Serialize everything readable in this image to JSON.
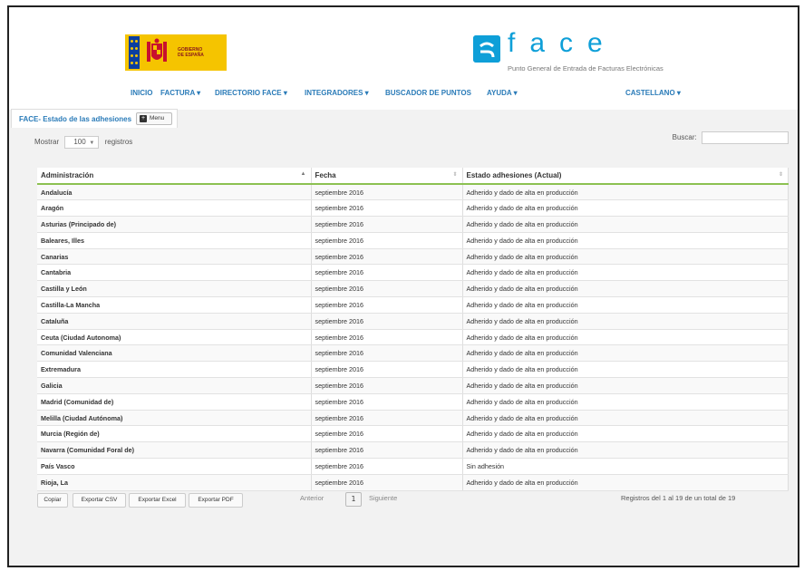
{
  "logos": {
    "gov_text_line1": "GOBIERNO",
    "gov_text_line2": "DE ESPAÑA",
    "face_word": "face",
    "face_tagline": "Punto General de Entrada de Facturas Electrónicas"
  },
  "nav": {
    "inicio": "INICIO",
    "factura": "FACTURA ▾",
    "directorio": "DIRECTORIO FACE ▾",
    "integradores": "INTEGRADORES ▾",
    "buscador": "BUSCADOR DE PUNTOS",
    "ayuda": "AYUDA ▾",
    "idioma": "CASTELLANO ▾"
  },
  "panel": {
    "title": "FACE- Estado de las adhesiones",
    "menu_label": "Menu"
  },
  "length_control": {
    "prefix": "Mostrar",
    "value": "100",
    "suffix": "registros"
  },
  "search": {
    "label": "Buscar:"
  },
  "table": {
    "columns": [
      "Administración",
      "Fecha",
      "Estado adhesiones (Actual)"
    ],
    "rows": [
      [
        "Andalucía",
        "septiembre 2016",
        "Adherido y dado de alta en producción"
      ],
      [
        "Aragón",
        "septiembre 2016",
        "Adherido y dado de alta en producción"
      ],
      [
        "Asturias (Principado de)",
        "septiembre 2016",
        "Adherido y dado de alta en producción"
      ],
      [
        "Baleares, Illes",
        "septiembre 2016",
        "Adherido y dado de alta en producción"
      ],
      [
        "Canarias",
        "septiembre 2016",
        "Adherido y dado de alta en producción"
      ],
      [
        "Cantabria",
        "septiembre 2016",
        "Adherido y dado de alta en producción"
      ],
      [
        "Castilla y León",
        "septiembre 2016",
        "Adherido y dado de alta en producción"
      ],
      [
        "Castilla-La Mancha",
        "septiembre 2016",
        "Adherido y dado de alta en producción"
      ],
      [
        "Cataluña",
        "septiembre 2016",
        "Adherido y dado de alta en producción"
      ],
      [
        "Ceuta (Ciudad Autonoma)",
        "septiembre 2016",
        "Adherido y dado de alta en producción"
      ],
      [
        "Comunidad Valenciana",
        "septiembre 2016",
        "Adherido y dado de alta en producción"
      ],
      [
        "Extremadura",
        "septiembre 2016",
        "Adherido y dado de alta en producción"
      ],
      [
        "Galicia",
        "septiembre 2016",
        "Adherido y dado de alta en producción"
      ],
      [
        "Madrid (Comunidad de)",
        "septiembre 2016",
        "Adherido y dado de alta en producción"
      ],
      [
        "Melilla (Ciudad Autónoma)",
        "septiembre 2016",
        "Adherido y dado de alta en producción"
      ],
      [
        "Murcia (Región de)",
        "septiembre 2016",
        "Adherido y dado de alta en producción"
      ],
      [
        "Navarra (Comunidad Foral de)",
        "septiembre 2016",
        "Adherido y dado de alta en producción"
      ],
      [
        "País Vasco",
        "septiembre 2016",
        "Sin adhesión"
      ],
      [
        "Rioja, La",
        "septiembre 2016",
        "Adherido y dado de alta en producción"
      ]
    ]
  },
  "export_buttons": {
    "copy": "Copiar",
    "csv": "Exportar CSV",
    "excel": "Exportar Excel",
    "pdf": "Exportar PDF"
  },
  "pagination": {
    "prev": "Anterior",
    "current": "1",
    "next": "Siguiente"
  },
  "info": "Registros del 1 al 19 de un total de 19",
  "colors": {
    "accent_blue": "#2a7bb8",
    "face_blue": "#0e9fd8",
    "header_underline": "#8cc152",
    "gov_yellow": "#f5c400"
  }
}
